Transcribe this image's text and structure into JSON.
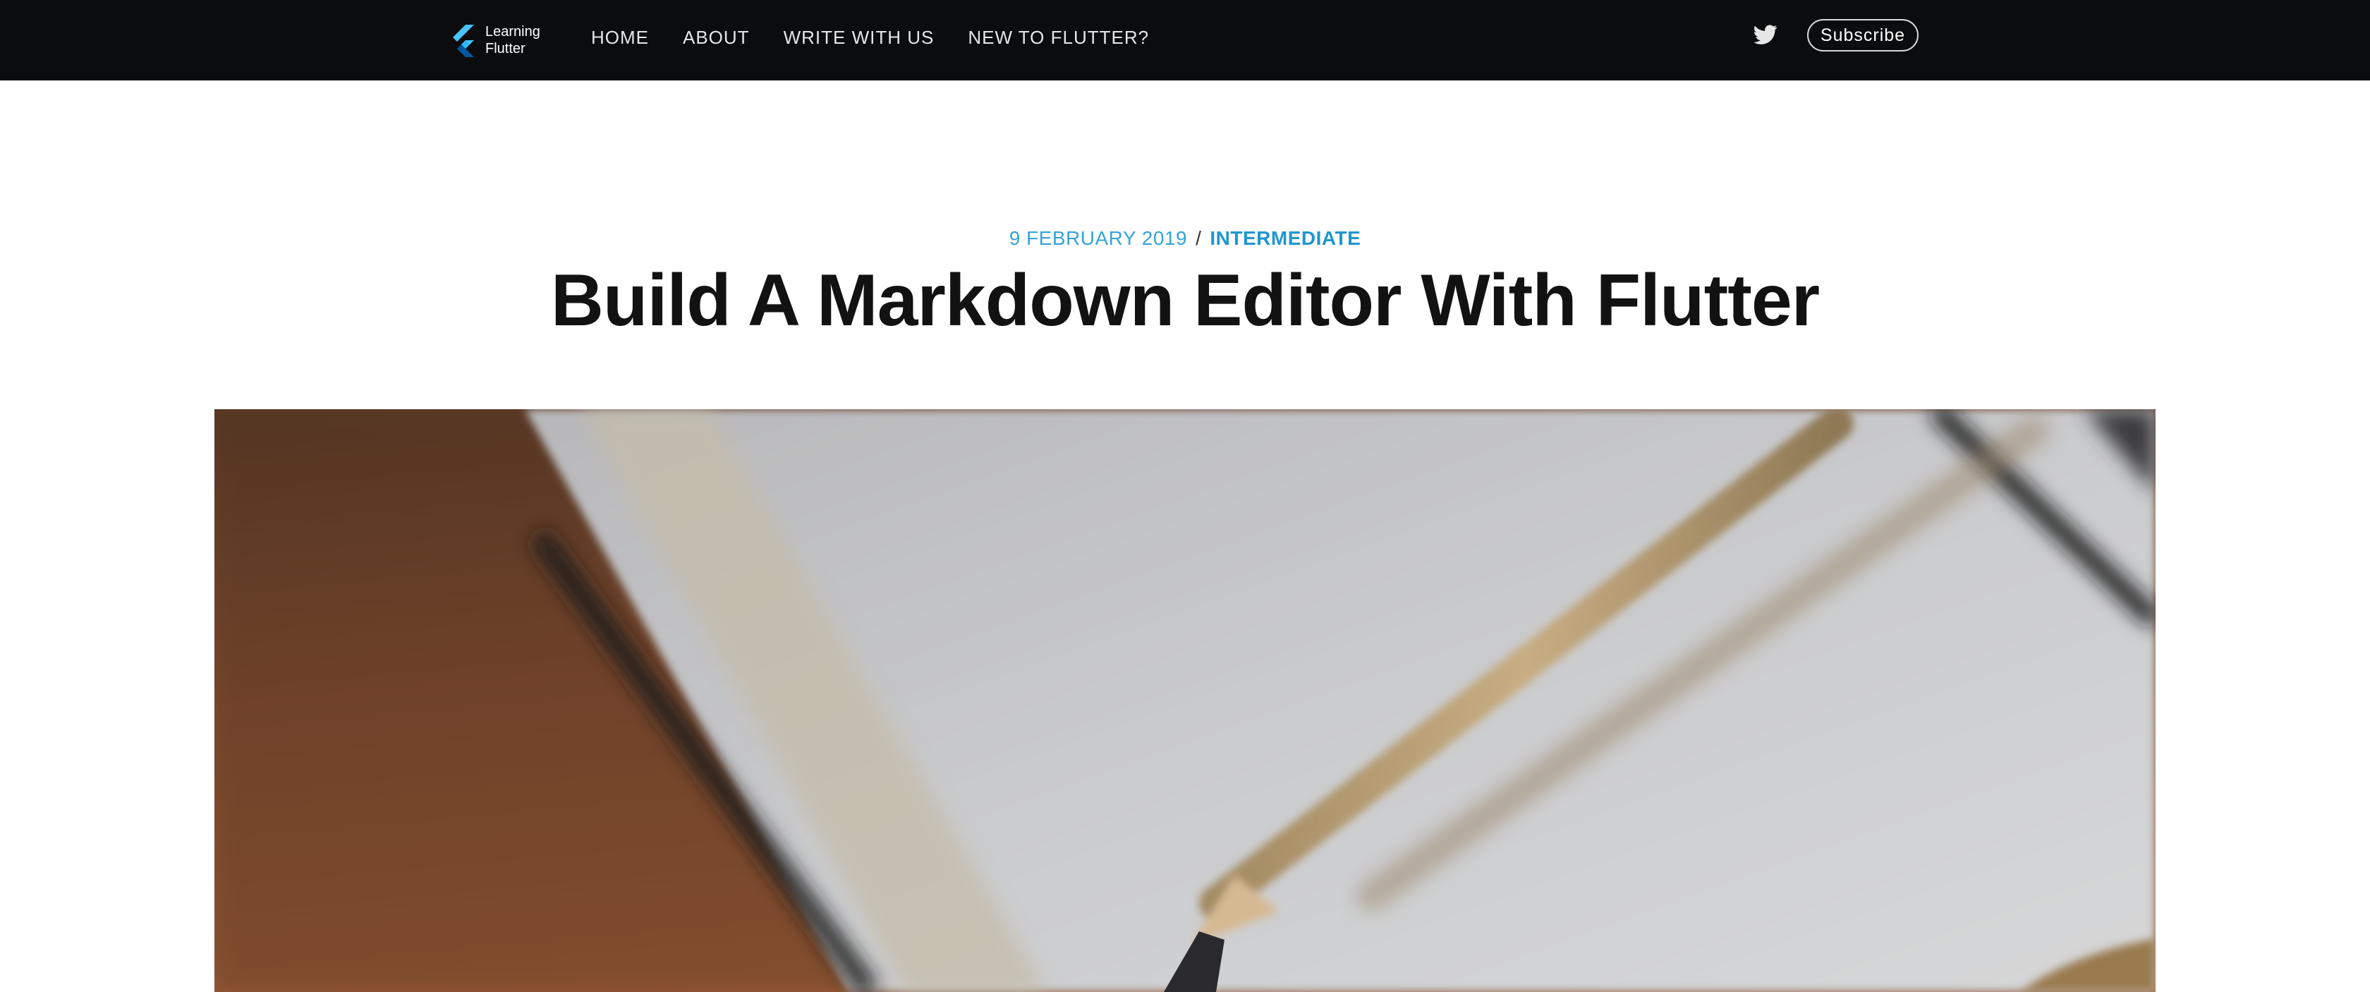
{
  "site": {
    "logo_line1": "Learning",
    "logo_line2": "Flutter",
    "logo_icon": "flutter-logo-icon",
    "brand_color": "#4ab7ea"
  },
  "nav": {
    "items": [
      {
        "label": "HOME"
      },
      {
        "label": "ABOUT"
      },
      {
        "label": "WRITE WITH US"
      },
      {
        "label": "NEW TO FLUTTER?"
      }
    ]
  },
  "header": {
    "twitter_icon": "twitter-icon",
    "subscribe_label": "Subscribe"
  },
  "post": {
    "date": "9 FEBRUARY 2019",
    "separator": "/",
    "tag": "INTERMEDIATE",
    "title": "Build A Markdown Editor With Flutter"
  },
  "hero": {
    "subject": "blurred photo of an open notebook with a pencil on a wooden desk"
  },
  "colors": {
    "header_bg": "#0b0c0e",
    "accent": "#1f97cf",
    "title_text": "#121212"
  }
}
